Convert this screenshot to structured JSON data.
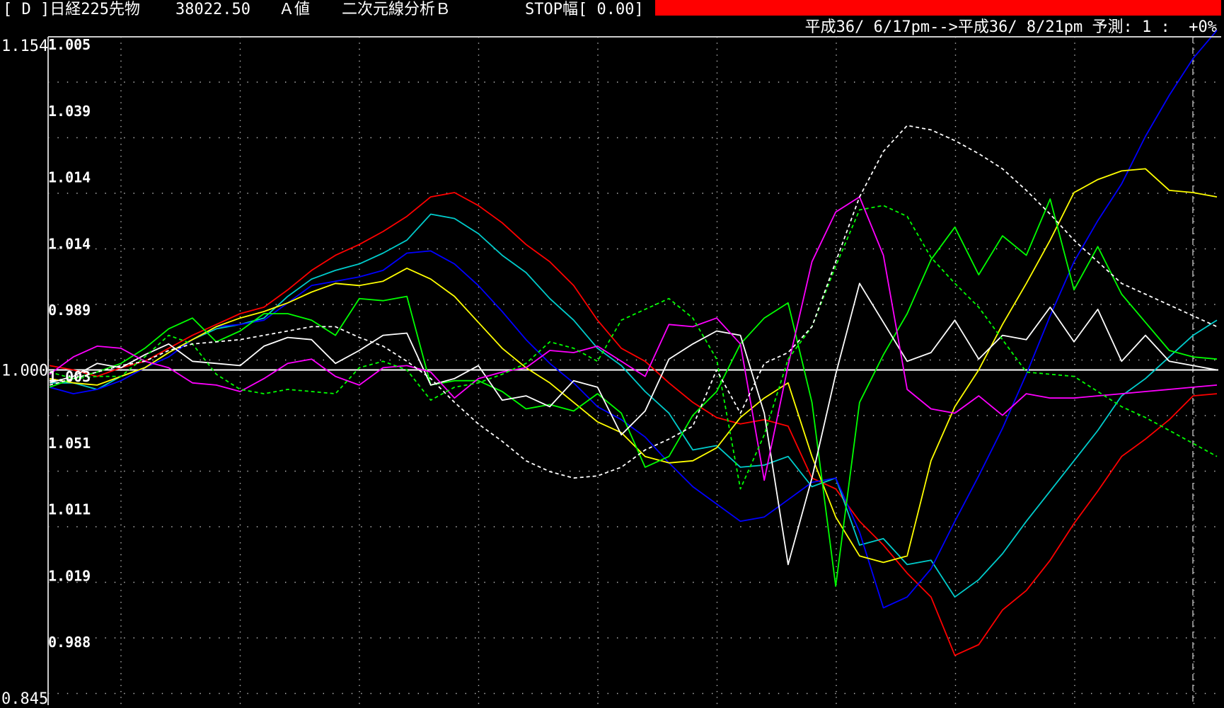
{
  "titlebar": {
    "label": "[ D ]日経225先物",
    "price": "38022.50",
    "mode": "Ａ値",
    "analysis": "二次元線分析Ｂ",
    "stop": "STOP幅[ 0.00]"
  },
  "subtitle": "平成36/ 6/17pm-->平成36/ 8/21pm 予測: 1 :  +0%",
  "colors": {
    "background": "#000000",
    "stop_bar": "#ff0000",
    "grid": "#bbbbbb",
    "baseline": "#ffffff",
    "text": "#ffffff"
  },
  "chart_data": {
    "type": "line",
    "left_axis": {
      "top_label": "1.154",
      "baseline_label": "1.000",
      "bottom_label": "0.845"
    },
    "inner_tick_labels": [
      "1.005",
      "1.039",
      "1.014",
      "1.014",
      "0.989",
      "1.003",
      "1.051",
      "1.011",
      "1.019",
      "0.988"
    ],
    "ylim": [
      0.845,
      1.154
    ],
    "baseline": 1.0,
    "grid": true,
    "x": [
      0,
      1,
      2,
      3,
      4,
      5,
      6,
      7,
      8,
      9,
      10,
      11,
      12,
      13,
      14,
      15,
      16,
      17,
      18,
      19,
      20,
      21,
      22,
      23,
      24,
      25,
      26,
      27,
      28,
      29,
      30,
      31,
      32,
      33,
      34,
      35,
      36,
      37,
      38,
      39,
      40,
      41,
      42,
      43,
      44,
      45,
      46,
      47,
      48,
      49
    ],
    "series": [
      {
        "color": "#ff0000",
        "dashed": false,
        "values": [
          1.002,
          1.0,
          0.997,
          1.001,
          1.004,
          1.01,
          1.016,
          1.021,
          1.026,
          1.029,
          1.037,
          1.046,
          1.053,
          1.058,
          1.064,
          1.071,
          1.08,
          1.082,
          1.076,
          1.068,
          1.058,
          1.05,
          1.039,
          1.023,
          1.01,
          1.004,
          0.994,
          0.985,
          0.978,
          0.975,
          0.977,
          0.974,
          0.95,
          0.945,
          0.93,
          0.919,
          0.906,
          0.895,
          0.868,
          0.873,
          0.889,
          0.898,
          0.912,
          0.929,
          0.944,
          0.96,
          0.968,
          0.977,
          0.988,
          0.989
        ]
      },
      {
        "color": "#00cccc",
        "dashed": false,
        "values": [
          0.994,
          0.994,
          0.991,
          0.997,
          1.001,
          1.008,
          1.014,
          1.019,
          1.021,
          1.024,
          1.034,
          1.042,
          1.046,
          1.049,
          1.054,
          1.06,
          1.072,
          1.07,
          1.063,
          1.053,
          1.045,
          1.033,
          1.023,
          1.01,
          1.002,
          0.99,
          0.98,
          0.963,
          0.965,
          0.955,
          0.956,
          0.96,
          0.946,
          0.95,
          0.919,
          0.922,
          0.91,
          0.912,
          0.895,
          0.903,
          0.915,
          0.93,
          0.944,
          0.958,
          0.972,
          0.988,
          0.996,
          1.006,
          1.016,
          1.023
        ]
      },
      {
        "color": "#0000ff",
        "dashed": false,
        "values": [
          0.992,
          0.989,
          0.991,
          0.995,
          1.001,
          1.006,
          1.014,
          1.02,
          1.021,
          1.023,
          1.031,
          1.039,
          1.041,
          1.043,
          1.046,
          1.054,
          1.055,
          1.049,
          1.039,
          1.027,
          1.014,
          1.003,
          0.994,
          0.983,
          0.977,
          0.969,
          0.957,
          0.946,
          0.938,
          0.93,
          0.932,
          0.94,
          0.948,
          0.95,
          0.925,
          0.89,
          0.895,
          0.908,
          0.93,
          0.951,
          0.973,
          0.998,
          1.025,
          1.05,
          1.069,
          1.086,
          1.108,
          1.127,
          1.144,
          1.157
        ]
      },
      {
        "color": "#ffff00",
        "dashed": false,
        "values": [
          0.996,
          0.994,
          0.993,
          0.997,
          1.001,
          1.008,
          1.014,
          1.02,
          1.024,
          1.027,
          1.031,
          1.036,
          1.04,
          1.039,
          1.041,
          1.047,
          1.042,
          1.034,
          1.022,
          1.01,
          1.001,
          0.994,
          0.985,
          0.976,
          0.971,
          0.96,
          0.957,
          0.958,
          0.964,
          0.978,
          0.987,
          0.994,
          0.96,
          0.932,
          0.914,
          0.911,
          0.914,
          0.958,
          0.983,
          1.0,
          1.021,
          1.04,
          1.06,
          1.082,
          1.088,
          1.092,
          1.093,
          1.083,
          1.082,
          1.08
        ]
      },
      {
        "color": "#00ff00",
        "dashed": false,
        "values": [
          0.992,
          0.996,
          0.999,
          1.003,
          1.01,
          1.019,
          1.024,
          1.013,
          1.018,
          1.026,
          1.026,
          1.023,
          1.016,
          1.033,
          1.032,
          1.034,
          0.993,
          0.995,
          0.995,
          0.99,
          0.982,
          0.984,
          0.981,
          0.989,
          0.98,
          0.955,
          0.96,
          0.979,
          0.99,
          1.012,
          1.024,
          1.031,
          0.985,
          0.9,
          0.985,
          1.007,
          1.026,
          1.051,
          1.066,
          1.044,
          1.062,
          1.053,
          1.079,
          1.037,
          1.057,
          1.035,
          1.022,
          1.009,
          1.006,
          1.005
        ]
      },
      {
        "color": "#ffffff",
        "dashed": false,
        "values": [
          0.994,
          0.997,
          1.003,
          1.001,
          1.007,
          1.012,
          1.004,
          1.003,
          1.002,
          1.011,
          1.015,
          1.014,
          1.003,
          1.009,
          1.016,
          1.017,
          0.993,
          0.996,
          1.002,
          0.986,
          0.988,
          0.983,
          0.995,
          0.992,
          0.97,
          0.981,
          1.005,
          1.012,
          1.018,
          1.016,
          0.98,
          0.91,
          0.95,
          0.998,
          1.04,
          1.022,
          1.004,
          1.008,
          1.023,
          1.005,
          1.016,
          1.014,
          1.029,
          1.013,
          1.028,
          1.004,
          1.016,
          1.004,
          1.002,
          1.0
        ]
      },
      {
        "color": "#ff00ff",
        "dashed": false,
        "values": [
          0.998,
          1.006,
          1.011,
          1.01,
          1.004,
          1.001,
          0.994,
          0.993,
          0.99,
          0.996,
          1.003,
          1.005,
          0.997,
          0.993,
          1.001,
          1.002,
          0.999,
          0.987,
          0.996,
          0.999,
          1.001,
          1.009,
          1.008,
          1.011,
          1.004,
          0.997,
          1.021,
          1.02,
          1.024,
          1.012,
          0.949,
          1.002,
          1.05,
          1.073,
          1.08,
          1.053,
          0.991,
          0.982,
          0.98,
          0.988,
          0.979,
          0.989,
          0.987,
          0.987,
          0.988,
          0.989,
          0.99,
          0.991,
          0.992,
          0.993
        ]
      },
      {
        "color": "#00ff00",
        "dashed": true,
        "values": [
          0.999,
          0.996,
          0.997,
          0.997,
          1.006,
          1.016,
          1.012,
          0.998,
          0.991,
          0.989,
          0.991,
          0.99,
          0.989,
          1.001,
          1.004,
          1.0,
          0.986,
          0.992,
          0.994,
          0.998,
          1.003,
          1.013,
          1.01,
          1.004,
          1.023,
          1.028,
          1.033,
          1.024,
          1.005,
          0.945,
          0.97,
          1.005,
          1.02,
          1.048,
          1.074,
          1.076,
          1.071,
          1.052,
          1.04,
          1.029,
          1.014,
          0.999,
          0.998,
          0.997,
          0.99,
          0.983,
          0.978,
          0.972,
          0.966,
          0.96
        ]
      },
      {
        "color": "#ffffff",
        "dashed": true,
        "values": [
          0.993,
          0.996,
          0.999,
          1.002,
          1.004,
          1.009,
          1.012,
          1.013,
          1.014,
          1.016,
          1.018,
          1.02,
          1.02,
          1.015,
          1.011,
          1.004,
          0.996,
          0.985,
          0.975,
          0.967,
          0.958,
          0.953,
          0.95,
          0.951,
          0.955,
          0.963,
          0.968,
          0.974,
          1.0,
          0.98,
          1.003,
          1.008,
          1.02,
          1.05,
          1.08,
          1.101,
          1.113,
          1.111,
          1.106,
          1.1,
          1.093,
          1.083,
          1.072,
          1.06,
          1.05,
          1.04,
          1.035,
          1.03,
          1.025,
          1.02
        ]
      }
    ]
  }
}
